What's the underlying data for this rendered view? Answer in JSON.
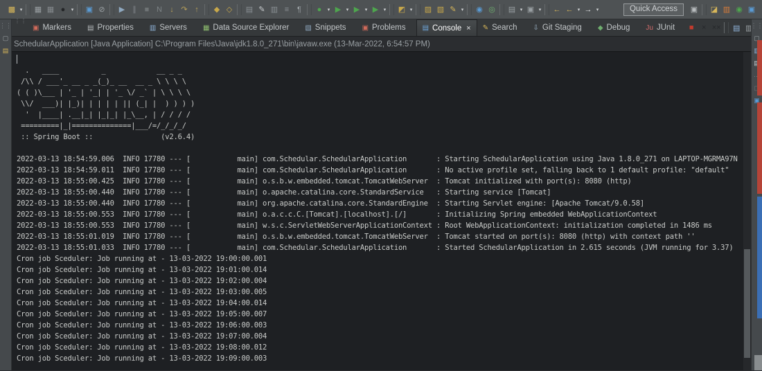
{
  "toolbar": {
    "quick_access_label": "Quick Access",
    "items": [
      {
        "name": "new-wizard-icon",
        "glyph": "▩",
        "color": "#d8b75a",
        "inter": "true"
      },
      {
        "name": "new-wizard-dropdown",
        "type": "dd",
        "glyph": "▾",
        "inter": "true"
      },
      {
        "name": "toolbar-separator",
        "type": "sep",
        "inter": "false"
      },
      {
        "name": "save-icon",
        "glyph": "▦",
        "color": "#9aa0a3",
        "inter": "true"
      },
      {
        "name": "save-all-icon",
        "glyph": "▦",
        "color": "#84898c",
        "inter": "true"
      },
      {
        "name": "user-icon",
        "glyph": "●",
        "color": "#232527",
        "inter": "true"
      },
      {
        "name": "user-dropdown",
        "type": "dd",
        "glyph": "▾",
        "inter": "true"
      },
      {
        "name": "toolbar-separator",
        "type": "sep",
        "inter": "false"
      },
      {
        "name": "window-icon",
        "glyph": "▣",
        "color": "#5a9bd4",
        "inter": "true"
      },
      {
        "name": "skip-breakpoints-icon",
        "glyph": "⊘",
        "color": "#9aa0a3",
        "inter": "true"
      },
      {
        "name": "toolbar-separator",
        "type": "sep",
        "inter": "false"
      },
      {
        "name": "resume-icon",
        "glyph": "▶",
        "color": "#8fa8bf",
        "inter": "true"
      },
      {
        "name": "pause-icon",
        "glyph": "∥",
        "color": "#7e8487",
        "inter": "true"
      },
      {
        "name": "terminate-icon",
        "glyph": "■",
        "color": "#6f7476",
        "inter": "true"
      },
      {
        "name": "disconnect-icon",
        "glyph": "N",
        "color": "#7e8487",
        "inter": "true"
      },
      {
        "name": "step-into-icon",
        "glyph": "↓",
        "color": "#b8a05a",
        "inter": "true"
      },
      {
        "name": "step-over-icon",
        "glyph": "↷",
        "color": "#b8a05a",
        "inter": "true"
      },
      {
        "name": "step-return-icon",
        "glyph": "↑",
        "color": "#b8a05a",
        "inter": "true"
      },
      {
        "name": "toolbar-separator",
        "type": "sep",
        "inter": "false"
      },
      {
        "name": "drop-to-frame-icon",
        "glyph": "◆",
        "color": "#c8a84b",
        "inter": "true"
      },
      {
        "name": "use-step-filters-icon",
        "glyph": "◇",
        "color": "#c8a84b",
        "inter": "true"
      },
      {
        "name": "toolbar-separator",
        "type": "sep",
        "inter": "false"
      },
      {
        "name": "open-console-icon",
        "glyph": "▤",
        "color": "#8a9094",
        "inter": "true"
      },
      {
        "name": "edit-icon",
        "glyph": "✎",
        "color": "#c8ccce",
        "inter": "true"
      },
      {
        "name": "task-icon",
        "glyph": "▥",
        "color": "#8a9094",
        "inter": "true"
      },
      {
        "name": "outline-icon",
        "glyph": "≡",
        "color": "#8a9094",
        "inter": "true"
      },
      {
        "name": "show-whitespace-icon",
        "glyph": "¶",
        "color": "#9aa0a3",
        "inter": "true"
      },
      {
        "name": "toolbar-separator",
        "type": "sep",
        "inter": "false"
      },
      {
        "name": "run-last-icon",
        "glyph": "●",
        "color": "#4ea64e",
        "inter": "true"
      },
      {
        "name": "run-last-dropdown",
        "type": "dd",
        "glyph": "▾",
        "inter": "true"
      },
      {
        "name": "run-icon",
        "glyph": "▶",
        "color": "#4ea64e",
        "inter": "true"
      },
      {
        "name": "run-dropdown",
        "type": "dd",
        "glyph": "▾",
        "inter": "true"
      },
      {
        "name": "coverage-icon",
        "glyph": "▶",
        "color": "#4ea64e",
        "inter": "true"
      },
      {
        "name": "coverage-dropdown",
        "type": "dd",
        "glyph": "▾",
        "inter": "true"
      },
      {
        "name": "profile-icon",
        "glyph": "▶",
        "color": "#4ea64e",
        "inter": "true"
      },
      {
        "name": "profile-dropdown",
        "type": "dd",
        "glyph": "▾",
        "inter": "true"
      },
      {
        "name": "toolbar-separator",
        "type": "sep",
        "inter": "false"
      },
      {
        "name": "external-tools-icon",
        "glyph": "◩",
        "color": "#c8a84b",
        "inter": "true"
      },
      {
        "name": "external-tools-dropdown",
        "type": "dd",
        "glyph": "▾",
        "inter": "true"
      },
      {
        "name": "toolbar-separator",
        "type": "sep",
        "inter": "false"
      },
      {
        "name": "import-icon",
        "glyph": "▨",
        "color": "#c8a84b",
        "inter": "true"
      },
      {
        "name": "export-icon",
        "glyph": "▧",
        "color": "#c8a84b",
        "inter": "true"
      },
      {
        "name": "search-pencil-icon",
        "glyph": "✎",
        "color": "#d8b75a",
        "inter": "true"
      },
      {
        "name": "search-dropdown",
        "type": "dd",
        "glyph": "▾",
        "inter": "true"
      },
      {
        "name": "toolbar-separator",
        "type": "sep",
        "inter": "false"
      },
      {
        "name": "browser-icon",
        "glyph": "◉",
        "color": "#5a9bd4",
        "inter": "true"
      },
      {
        "name": "web-service-icon",
        "glyph": "◎",
        "color": "#6fae6f",
        "inter": "true"
      },
      {
        "name": "toolbar-separator",
        "type": "sep",
        "inter": "false"
      },
      {
        "name": "new-class-icon",
        "glyph": "▤",
        "color": "#9aa0a3",
        "inter": "true"
      },
      {
        "name": "new-class-dropdown",
        "type": "dd",
        "glyph": "▾",
        "inter": "true"
      },
      {
        "name": "last-tool-icon",
        "glyph": "▣",
        "color": "#9aa0a3",
        "inter": "true"
      },
      {
        "name": "last-tool-dropdown",
        "type": "dd",
        "glyph": "▾",
        "inter": "true"
      },
      {
        "name": "toolbar-separator",
        "type": "sep",
        "inter": "false"
      },
      {
        "name": "back-icon",
        "glyph": "←",
        "color": "#d8b75a",
        "inter": "true"
      },
      {
        "name": "back-history-icon",
        "glyph": "←",
        "color": "#d8b75a",
        "inter": "true"
      },
      {
        "name": "back-history-dropdown",
        "type": "dd",
        "glyph": "▾",
        "inter": "true"
      },
      {
        "name": "forward-icon",
        "glyph": "→",
        "color": "#e8eaec",
        "inter": "true"
      },
      {
        "name": "forward-dropdown",
        "type": "dd",
        "glyph": "▾",
        "inter": "true"
      }
    ],
    "perspective_items": [
      {
        "name": "open-perspective-icon",
        "glyph": "▣",
        "color": "#b8bcbe",
        "inter": "true"
      },
      {
        "name": "toolbar-separator",
        "type": "sep",
        "inter": "false"
      },
      {
        "name": "perspective-javaee-icon",
        "glyph": "◪",
        "color": "#d8b75a",
        "state": "pressed",
        "inter": "true"
      },
      {
        "name": "perspective-git-icon",
        "glyph": "▥",
        "color": "#d87c3a",
        "inter": "true"
      },
      {
        "name": "perspective-debug-icon",
        "glyph": "◉",
        "color": "#4ea64e",
        "inter": "true"
      },
      {
        "name": "perspective-java-icon",
        "glyph": "▣",
        "color": "#5a9bd4",
        "inter": "true"
      }
    ]
  },
  "tabs": {
    "items": [
      {
        "name": "tab-markers",
        "icon_name": "markers-icon",
        "glyph": "▣",
        "color": "#d06a5a",
        "label": "Markers"
      },
      {
        "name": "tab-properties",
        "icon_name": "properties-icon",
        "glyph": "▤",
        "color": "#b8bcbe",
        "label": "Properties"
      },
      {
        "name": "tab-servers",
        "icon_name": "servers-icon",
        "glyph": "▥",
        "color": "#8fb3d9",
        "label": "Servers"
      },
      {
        "name": "tab-data-source-explorer",
        "icon_name": "data-source-explorer-icon",
        "glyph": "▦",
        "color": "#8fbf6f",
        "label": "Data Source Explorer"
      },
      {
        "name": "tab-snippets",
        "icon_name": "snippets-icon",
        "glyph": "▧",
        "color": "#8fa8bf",
        "label": "Snippets"
      },
      {
        "name": "tab-problems",
        "icon_name": "problems-icon",
        "glyph": "▣",
        "color": "#d06a5a",
        "label": "Problems"
      },
      {
        "name": "tab-console",
        "icon_name": "console-icon",
        "glyph": "▤",
        "color": "#6fa8dc",
        "label": "Console",
        "state": "active",
        "close": "×",
        "close_name": "close-console-icon"
      },
      {
        "name": "tab-search",
        "icon_name": "search-icon",
        "glyph": "✎",
        "color": "#d8b75a",
        "label": "Search"
      },
      {
        "name": "tab-git-staging",
        "icon_name": "git-staging-icon",
        "glyph": "⇩",
        "color": "#9ab0c4",
        "label": "Git Staging"
      },
      {
        "name": "tab-debug",
        "icon_name": "debug-icon",
        "glyph": "◆",
        "color": "#6fae6f",
        "label": "Debug"
      },
      {
        "name": "tab-junit",
        "icon_name": "junit-icon",
        "glyph": "Ju",
        "color": "#cf6a6a",
        "label": "JUnit"
      }
    ]
  },
  "console_toolbar": {
    "items": [
      {
        "name": "terminate-console-icon",
        "glyph": "■",
        "color": "#c23b2e",
        "inter": "true"
      },
      {
        "name": "remove-launch-icon",
        "glyph": "×",
        "color": "#25272a",
        "inter": "true"
      },
      {
        "name": "remove-all-launches-icon",
        "glyph": "××",
        "color": "#25272a",
        "inter": "true"
      },
      {
        "name": "toolbar-separator",
        "type": "sep",
        "inter": "false"
      },
      {
        "name": "clear-console-icon",
        "glyph": "▤",
        "color": "#8fb3d9",
        "inter": "true"
      },
      {
        "name": "scroll-lock-icon",
        "glyph": "▥",
        "color": "#9aa0a3",
        "inter": "true"
      },
      {
        "name": "word-wrap-icon",
        "glyph": "↩",
        "color": "#9aa0a3",
        "inter": "true"
      },
      {
        "name": "show-stdout-icon",
        "glyph": "▤",
        "color": "#d4d7d9",
        "state": "pressed",
        "inter": "true"
      },
      {
        "name": "show-stderr-icon",
        "glyph": "▤",
        "color": "#d4d7d9",
        "state": "pressed",
        "inter": "true"
      },
      {
        "name": "toolbar-separator",
        "type": "sep",
        "inter": "false"
      },
      {
        "name": "pin-console-icon",
        "glyph": "▣",
        "color": "#6fae6f",
        "inter": "true"
      },
      {
        "name": "display-console-icon",
        "glyph": "▦",
        "color": "#9aa0a3",
        "inter": "true"
      },
      {
        "name": "display-console-dropdown",
        "type": "dd",
        "glyph": "▾",
        "inter": "true"
      },
      {
        "name": "open-console-dropdown-icon",
        "glyph": "▩",
        "color": "#d8b75a",
        "inter": "true"
      },
      {
        "name": "open-console-dropdown",
        "type": "dd",
        "glyph": "▾",
        "inter": "true"
      },
      {
        "name": "minimize-view-icon",
        "glyph": "—",
        "color": "#d4d7d9",
        "inter": "true"
      },
      {
        "name": "maximize-view-icon",
        "glyph": "▢",
        "color": "#d4d7d9",
        "inter": "true"
      }
    ]
  },
  "left_strip": {
    "items": [
      {
        "name": "left-strip-handle",
        "glyph": "⋮⋮",
        "color": "#7e8487",
        "inter": "true"
      },
      {
        "name": "restore-left-view-icon",
        "glyph": "▢",
        "color": "#9aa0a3",
        "inter": "true"
      },
      {
        "name": "minimized-console-view-icon",
        "glyph": "▤",
        "color": "#d8b75a",
        "inter": "true"
      }
    ]
  },
  "right_strip": {
    "items": [
      {
        "name": "right-strip-handle",
        "glyph": "⋮⋮",
        "color": "#7e8487",
        "inter": "true"
      },
      {
        "name": "restore-right-view-icon",
        "glyph": "▢",
        "color": "#9aa0a3",
        "inter": "true"
      },
      {
        "name": "minimized-servers-icon",
        "glyph": "▥",
        "color": "#8fb3d9",
        "inter": "true"
      },
      {
        "name": "minimized-outline-icon",
        "glyph": "▤",
        "color": "#c8ccce",
        "inter": "true"
      },
      {
        "name": "right-strip-overflow",
        "glyph": "···",
        "color": "#7e8487",
        "inter": "true"
      },
      {
        "name": "minimized-faded-view-icon",
        "glyph": "▢",
        "color": "#6f7476",
        "inter": "true"
      },
      {
        "name": "minimized-snippets-icon",
        "glyph": "▣",
        "color": "#5a9bd4",
        "inter": "true"
      }
    ]
  },
  "console": {
    "title": "SchedularApplication [Java Application] C:\\Program Files\\Java\\jdk1.8.0_271\\bin\\javaw.exe (13-Mar-2022, 6:54:57 PM)",
    "lines": [
      "",
      "  .   ____          _            __ _ _",
      " /\\\\ / ___'_ __ _ _(_)_ __  __ _ \\ \\ \\ \\",
      "( ( )\\___ | '_ | '_| | '_ \\/ _` | \\ \\ \\ \\",
      " \\\\/  ___)| |_)| | | | | || (_| |  ) ) ) )",
      "  '  |____| .__|_| |_|_| |_\\__, | / / / /",
      " =========|_|==============|___/=/_/_/_/",
      " :: Spring Boot ::                (v2.6.4)",
      "",
      "2022-03-13 18:54:59.006  INFO 17780 --- [           main] com.Schedular.SchedularApplication       : Starting SchedularApplication using Java 1.8.0_271 on LAPTOP-MGRMA97N",
      "2022-03-13 18:54:59.011  INFO 17780 --- [           main] com.Schedular.SchedularApplication       : No active profile set, falling back to 1 default profile: \"default\"",
      "2022-03-13 18:55:00.425  INFO 17780 --- [           main] o.s.b.w.embedded.tomcat.TomcatWebServer  : Tomcat initialized with port(s): 8080 (http)",
      "2022-03-13 18:55:00.440  INFO 17780 --- [           main] o.apache.catalina.core.StandardService   : Starting service [Tomcat]",
      "2022-03-13 18:55:00.440  INFO 17780 --- [           main] org.apache.catalina.core.StandardEngine  : Starting Servlet engine: [Apache Tomcat/9.0.58]",
      "2022-03-13 18:55:00.553  INFO 17780 --- [           main] o.a.c.c.C.[Tomcat].[localhost].[/]       : Initializing Spring embedded WebApplicationContext",
      "2022-03-13 18:55:00.553  INFO 17780 --- [           main] w.s.c.ServletWebServerApplicationContext : Root WebApplicationContext: initialization completed in 1486 ms",
      "2022-03-13 18:55:01.019  INFO 17780 --- [           main] o.s.b.w.embedded.tomcat.TomcatWebServer  : Tomcat started on port(s): 8080 (http) with context path ''",
      "2022-03-13 18:55:01.033  INFO 17780 --- [           main] com.Schedular.SchedularApplication       : Started SchedularApplication in 2.615 seconds (JVM running for 3.37)",
      "Cron job Sceduler: Job running at - 13-03-2022 19:00:00.001",
      "Cron job Sceduler: Job running at - 13-03-2022 19:01:00.014",
      "Cron job Sceduler: Job running at - 13-03-2022 19:02:00.004",
      "Cron job Sceduler: Job running at - 13-03-2022 19:03:00.005",
      "Cron job Sceduler: Job running at - 13-03-2022 19:04:00.014",
      "Cron job Sceduler: Job running at - 13-03-2022 19:05:00.007",
      "Cron job Sceduler: Job running at - 13-03-2022 19:06:00.003",
      "Cron job Sceduler: Job running at - 13-03-2022 19:07:00.004",
      "Cron job Sceduler: Job running at - 13-03-2022 19:08:00.012",
      "Cron job Sceduler: Job running at - 13-03-2022 19:09:00.003"
    ]
  },
  "colors": {
    "toolbar_bg": "#4e5254",
    "tabbar_bg": "#35383a",
    "console_bg": "#1e2023",
    "console_text": "#c9cbc9",
    "terminate_red": "#c23b2e",
    "edge_red": "#b54438",
    "edge_blue": "#3b6fb5",
    "accent_blue": "#6fa8dc"
  }
}
